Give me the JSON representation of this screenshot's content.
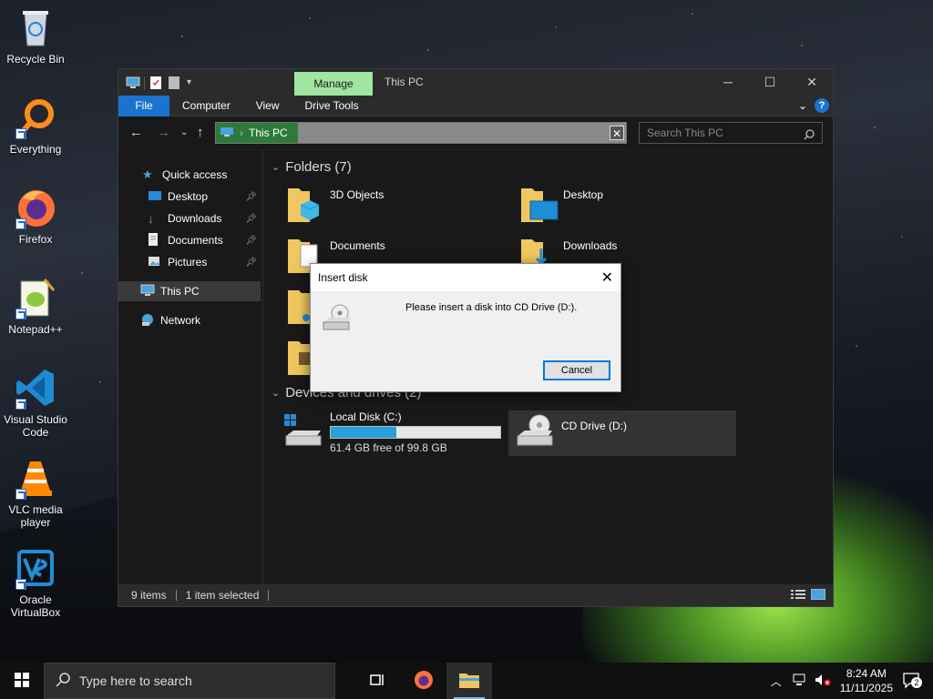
{
  "desktop": {
    "icons": [
      {
        "label": "Recycle Bin",
        "icon": "recycle-bin-icon"
      },
      {
        "label": "Everything",
        "icon": "everything-search-icon"
      },
      {
        "label": "Firefox",
        "icon": "firefox-icon"
      },
      {
        "label": "Notepad++",
        "icon": "notepad-plus-plus-icon"
      },
      {
        "label": "Visual Studio Code",
        "icon": "vscode-icon"
      },
      {
        "label": "VLC media player",
        "icon": "vlc-icon"
      },
      {
        "label": "Oracle VirtualBox",
        "icon": "virtualbox-icon"
      }
    ]
  },
  "explorer": {
    "title": "This PC",
    "manage_tab": "Manage",
    "ribbon": {
      "file": "File",
      "computer": "Computer",
      "view": "View",
      "drive_tools": "Drive Tools"
    },
    "address": {
      "crumb": "This PC"
    },
    "search": {
      "placeholder": "Search This PC"
    },
    "nav": {
      "quick_access": "Quick access",
      "desktop": "Desktop",
      "downloads": "Downloads",
      "documents": "Documents",
      "pictures": "Pictures",
      "this_pc": "This PC",
      "network": "Network"
    },
    "folders_header": "Folders (7)",
    "folders": [
      {
        "name": "3D Objects"
      },
      {
        "name": "Desktop"
      },
      {
        "name": "Documents"
      },
      {
        "name": "Downloads"
      }
    ],
    "devices_header": "Devices and drives (2)",
    "drives": {
      "local": {
        "name": "Local Disk (C:)",
        "free": "61.4 GB free of 99.8 GB",
        "used_fraction": 0.385
      },
      "cd": {
        "name": "CD Drive (D:)"
      }
    },
    "status": {
      "items": "9 items",
      "selected": "1 item selected"
    }
  },
  "dialog": {
    "title": "Insert disk",
    "message": "Please insert a disk into CD Drive (D:).",
    "cancel": "Cancel"
  },
  "taskbar": {
    "search_placeholder": "Type here to search",
    "time": "8:24 AM",
    "date": "11/11/2025",
    "notifications": "2"
  },
  "colors": {
    "accent": "#1a73cf",
    "manage_tab": "#9fe6a0",
    "address_crumb": "#2e7a3a",
    "progress": "#26a0da"
  }
}
